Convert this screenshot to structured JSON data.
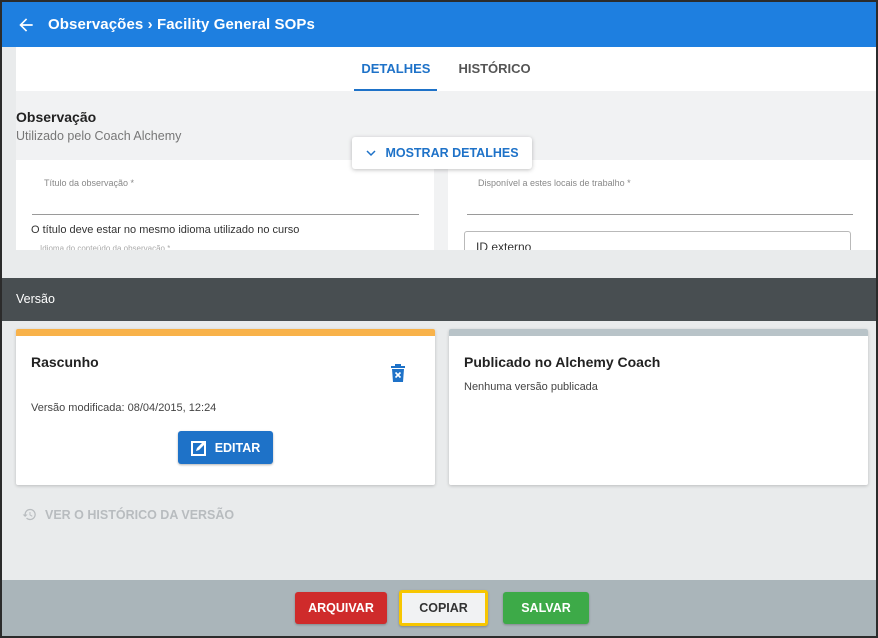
{
  "header": {
    "title": "Observações › Facility General SOPs",
    "back_icon": "arrow-left-icon"
  },
  "tabs": [
    {
      "label": "DETALHES",
      "active": true
    },
    {
      "label": "HISTÓRICO",
      "active": false
    }
  ],
  "details": {
    "title": "Observação",
    "subtitle": "Utilizado pelo Coach Alchemy",
    "show_more_label": "MOSTRAR DETALHES",
    "fields": {
      "title_label": "Título da observação *",
      "title_hint": "O título deve estar no mesmo idioma utilizado no curso",
      "language_label": "Idioma do conteúdo da observação *",
      "locations_label": "Disponível a estes locais de trabalho *",
      "external_id_label": "ID externo"
    }
  },
  "version": {
    "section_title": "Versão",
    "draft": {
      "title": "Rascunho",
      "modified": "Versão modificada: 08/04/2015, 12:24",
      "edit_label": "EDITAR",
      "stripe_color": "#f8b24a"
    },
    "published": {
      "title": "Publicado no Alchemy Coach",
      "status": "Nenhuma versão publicada",
      "stripe_color": "#b8c3c8"
    },
    "history_link": "VER O HISTÓRICO DA VERSÃO"
  },
  "actions": {
    "archive": "ARQUIVAR",
    "copy": "COPIAR",
    "save": "SALVAR"
  },
  "colors": {
    "primary": "#1e7fe0",
    "danger": "#cf2b2b",
    "success": "#3daa48",
    "highlight": "#f7c600"
  }
}
